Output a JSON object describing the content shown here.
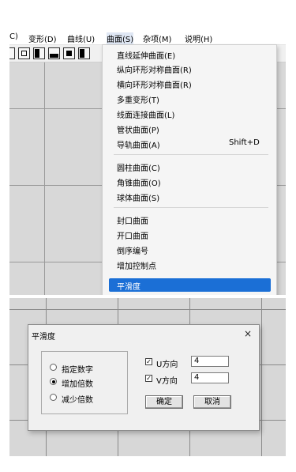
{
  "menubar": {
    "items": [
      "C)",
      "变形(D)",
      "曲线(U)",
      "曲面(S)",
      "杂项(M)",
      "说明(H)"
    ]
  },
  "dropdown": {
    "groups": [
      [
        "直线延伸曲面(E)",
        "纵向环形对称曲面(R)",
        "横向环形对称曲面(R)",
        "多重变形(T)",
        "线面连接曲面(L)",
        "管状曲面(P)"
      ],
      [
        "导轨曲面(A)"
      ],
      [
        "圆柱曲面(C)",
        "角锥曲面(O)",
        "球体曲面(S)"
      ],
      [
        "封口曲面",
        "开口曲面",
        "倒序编号",
        "增加控制点",
        "平滑度"
      ]
    ],
    "shortcut": "Shift+D",
    "selected": "平滑度"
  },
  "toolbar": {
    "zoom_icon": "⊕"
  },
  "dialog": {
    "title": "平滑度",
    "close_icon": "×",
    "radios": [
      "指定数字",
      "增加倍数",
      "减少倍数"
    ],
    "selected_radio": "增加倍数",
    "u_label": "U方向",
    "v_label": "V方向",
    "u_value": "4",
    "v_value": "4",
    "u_checked": true,
    "v_checked": true,
    "check_mark": "☑",
    "ok_label": "确定",
    "cancel_label": "取消"
  },
  "colors": {
    "selection": "#1b6fd6",
    "menu_bg": "#f5f5f5",
    "viewport": "#d8d8d8"
  }
}
